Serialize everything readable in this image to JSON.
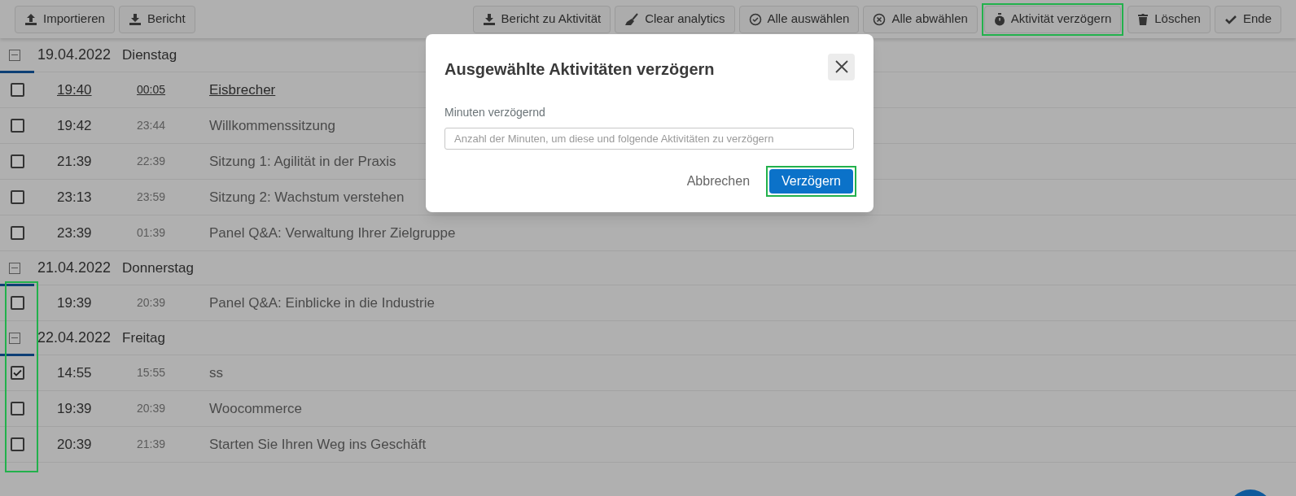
{
  "toolbar": {
    "left": [
      {
        "label": "Importieren",
        "highlighted": false
      },
      {
        "label": "Bericht",
        "highlighted": false
      }
    ],
    "right": [
      {
        "label": "Bericht zu Aktivität",
        "highlighted": false
      },
      {
        "label": "Clear analytics",
        "highlighted": false
      },
      {
        "label": "Alle auswählen",
        "highlighted": false
      },
      {
        "label": "Alle abwählen",
        "highlighted": false
      },
      {
        "label": "Aktivität verzögern",
        "highlighted": true
      },
      {
        "label": "Löschen",
        "highlighted": false
      },
      {
        "label": "Ende",
        "highlighted": false
      }
    ]
  },
  "groups": [
    {
      "date": "19.04.2022",
      "weekday": "Dienstag",
      "expanded": true,
      "checkboxes_highlighted": false,
      "items": [
        {
          "start": "19:40",
          "end": "00:05",
          "title": "Eisbrecher",
          "checked": false,
          "current": true
        },
        {
          "start": "19:42",
          "end": "23:44",
          "title": "Willkommenssitzung",
          "checked": false,
          "current": false
        },
        {
          "start": "21:39",
          "end": "22:39",
          "title": "Sitzung 1: Agilität in der Praxis",
          "checked": false,
          "current": false
        },
        {
          "start": "23:13",
          "end": "23:59",
          "title": "Sitzung 2: Wachstum verstehen",
          "checked": false,
          "current": false
        },
        {
          "start": "23:39",
          "end": "01:39",
          "title": "Panel Q&A: Verwaltung Ihrer Zielgruppe",
          "checked": false,
          "current": false
        }
      ]
    },
    {
      "date": "21.04.2022",
      "weekday": "Donnerstag",
      "expanded": true,
      "checkboxes_highlighted": true,
      "items": [
        {
          "start": "19:39",
          "end": "20:39",
          "title": "Panel Q&A: Einblicke in die Industrie",
          "checked": false,
          "current": false
        }
      ]
    },
    {
      "date": "22.04.2022",
      "weekday": "Freitag",
      "expanded": true,
      "checkboxes_highlighted": true,
      "items": [
        {
          "start": "14:55",
          "end": "15:55",
          "title": "ss",
          "checked": true,
          "current": false
        },
        {
          "start": "19:39",
          "end": "20:39",
          "title": "Woocommerce",
          "checked": false,
          "current": false
        },
        {
          "start": "20:39",
          "end": "21:39",
          "title": "Starten Sie Ihren Weg ins Geschäft",
          "checked": false,
          "current": false
        }
      ]
    }
  ],
  "dialog": {
    "title": "Ausgewählte Aktivitäten verzögern",
    "field_label": "Minuten verzögernd",
    "placeholder": "Anzahl der Minuten, um diese und folgende Aktivitäten zu verzögern",
    "buttons": [
      {
        "label": "Abbrechen",
        "kind": "secondary",
        "highlighted": false
      },
      {
        "label": "Verzögern",
        "kind": "primary",
        "highlighted": true
      }
    ]
  }
}
